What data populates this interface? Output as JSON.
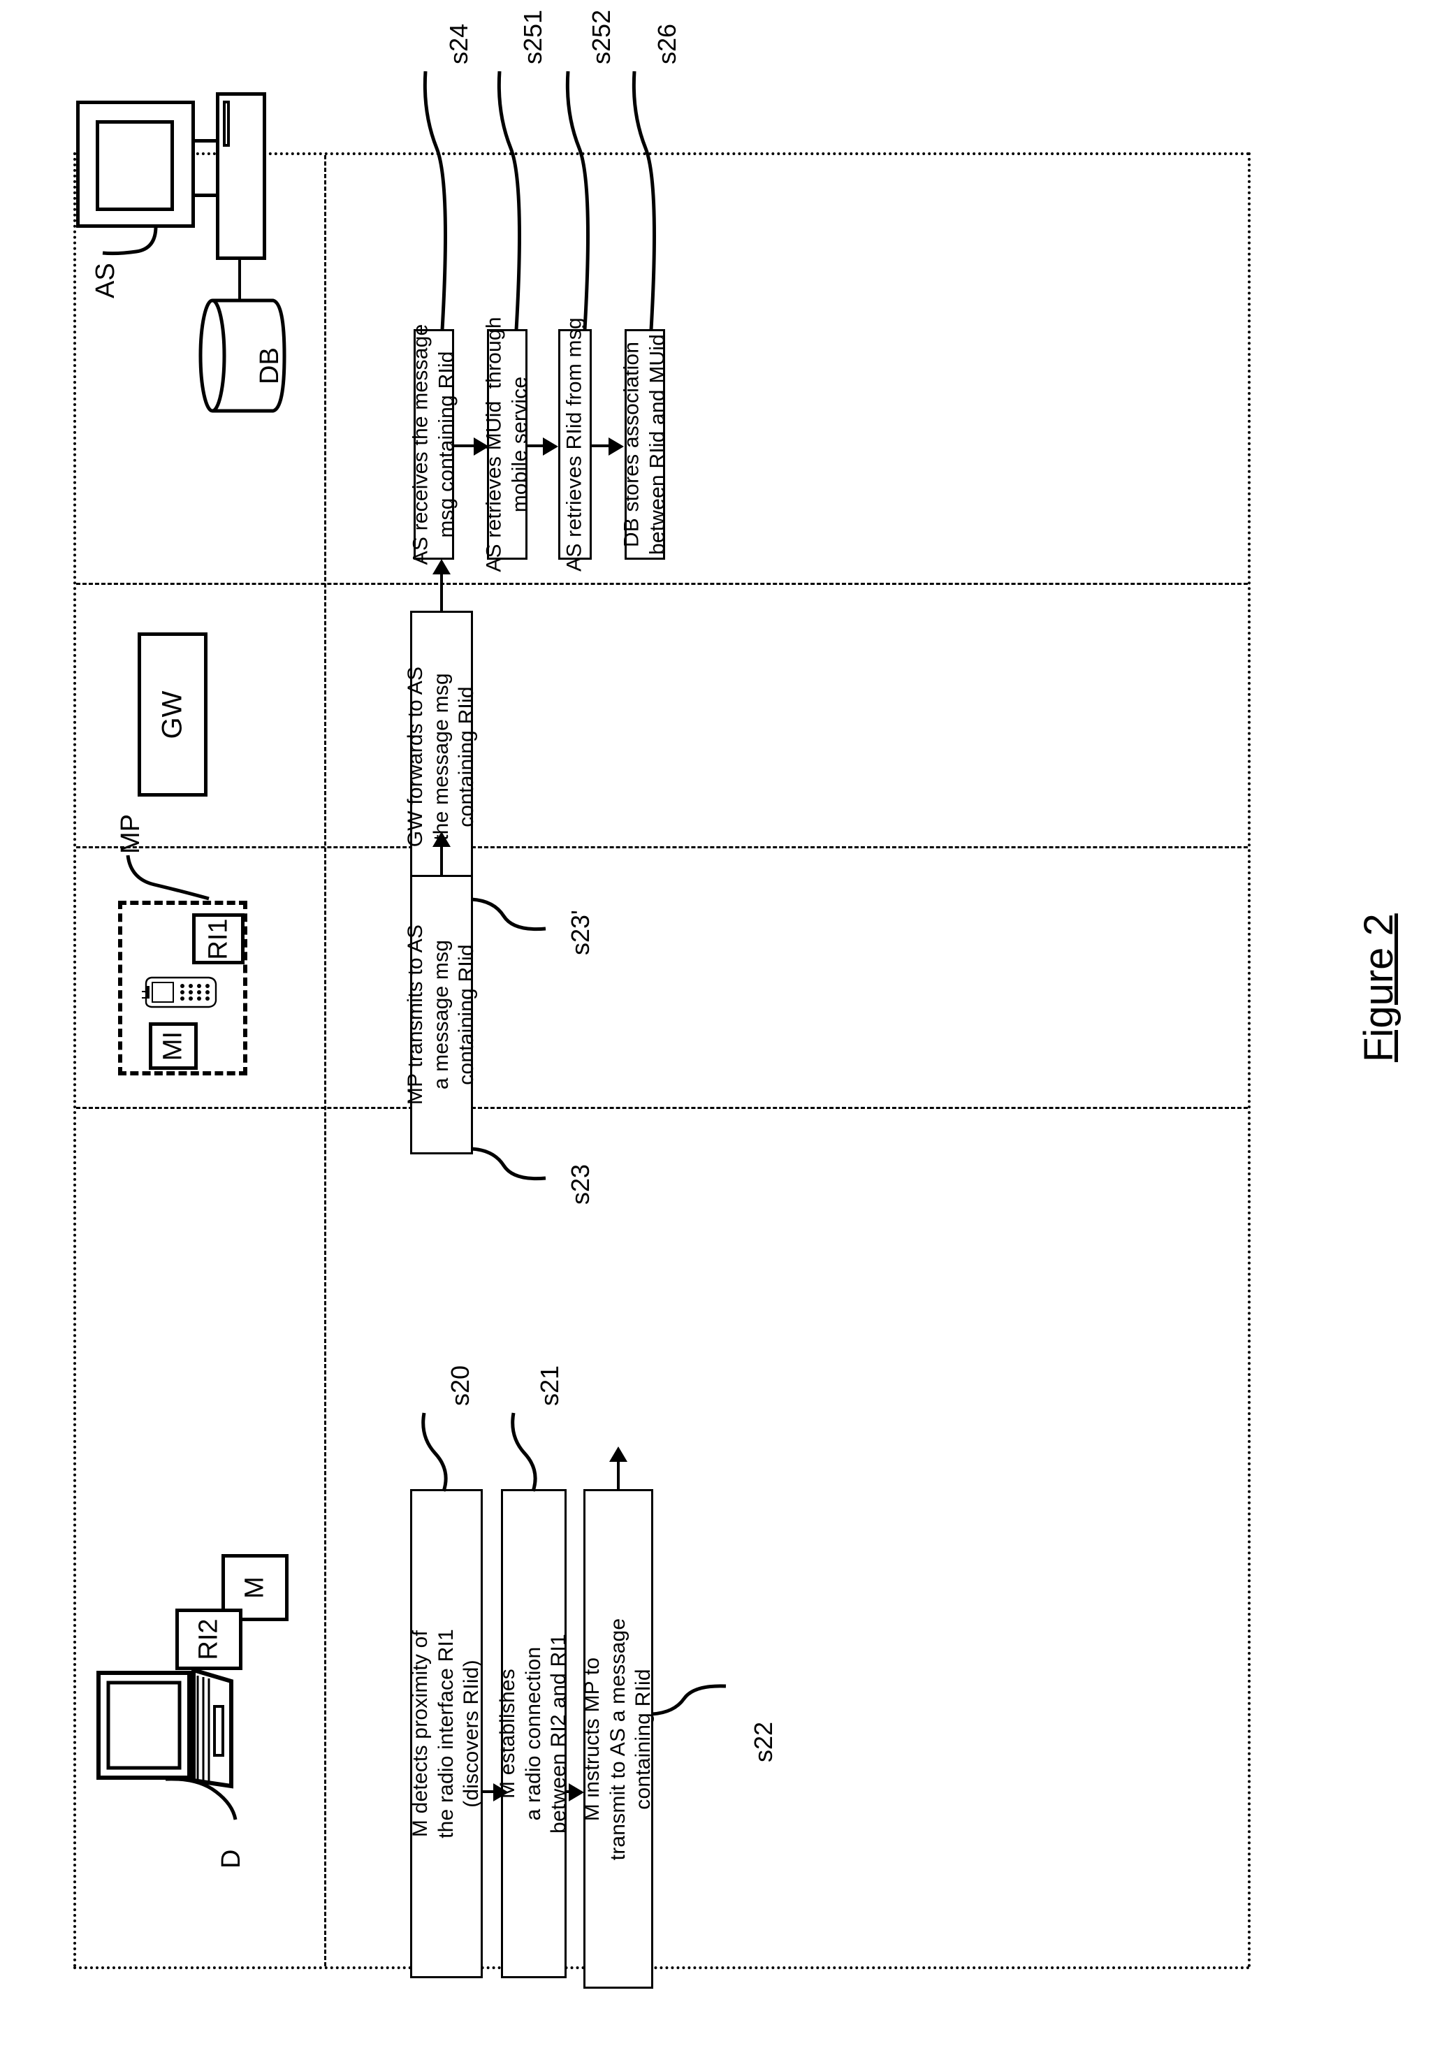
{
  "figure": {
    "caption": "Figure 2"
  },
  "lanes": [
    {
      "id": "as",
      "actor_label": "AS",
      "store_label": "DB"
    },
    {
      "id": "gw",
      "actor_label": "GW"
    },
    {
      "id": "mp",
      "actor_label": "MP",
      "sub_labels": [
        "RI1",
        "MI"
      ]
    },
    {
      "id": "d",
      "actor_label": "D",
      "sub_labels": [
        "RI2",
        "M"
      ]
    }
  ],
  "steps": [
    {
      "ref": "s24",
      "lane": "as",
      "text": "AS receives the message\nmsg containing RIid"
    },
    {
      "ref": "s251",
      "lane": "as",
      "text": "AS retrieves MUid  through\nmobile service"
    },
    {
      "ref": "s252",
      "lane": "as",
      "text": "AS retrieves RIid from msg"
    },
    {
      "ref": "s26",
      "lane": "as",
      "text": "DB stores association\nbetween RIid and MUid"
    },
    {
      "ref": "s23'",
      "lane": "gw",
      "text": "GW forwards to AS\nthe message msg\ncontaining RIid"
    },
    {
      "ref": "s23",
      "lane": "mp",
      "text": "MP transmits to AS\na message msg\ncontaining RIid"
    },
    {
      "ref": "s20",
      "lane": "d",
      "text": "M detects proximity of\nthe radio interface RI1\n(discovers RIid)"
    },
    {
      "ref": "s21",
      "lane": "d",
      "text": "M establishes\na radio connection\nbetween RI2 and RI1"
    },
    {
      "ref": "s22",
      "lane": "d",
      "text": "M instructs MP to\ntransmit to AS a message\ncontaining RIid"
    }
  ],
  "refs": {
    "s20": "s20",
    "s21": "s21",
    "s22": "s22",
    "s23": "s23",
    "s23p": "s23'",
    "s24": "s24",
    "s251": "s251",
    "s252": "s252",
    "s26": "s26"
  },
  "colors": {
    "ink": "#000000",
    "paper": "#ffffff"
  }
}
